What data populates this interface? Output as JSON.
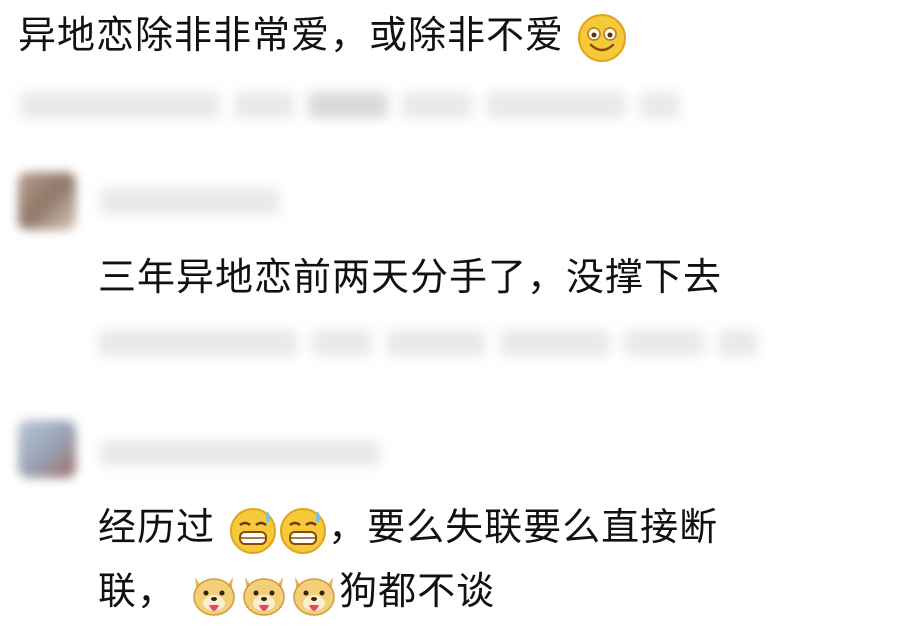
{
  "post": {
    "text": "异地恋除非非常爱，或除非不爱",
    "emoji": "smile-emoji"
  },
  "comment1": {
    "text": "三年异地恋前两天分手了，没撑下去"
  },
  "comment2": {
    "line1_before": "经历过",
    "line1_after": "，要么失联要么直接断",
    "line2_before": "联，",
    "line2_after": "狗都不谈",
    "emojis": [
      "sweat-grin-emoji",
      "sweat-grin-emoji",
      "doge-tongue-emoji",
      "doge-tongue-emoji",
      "doge-tongue-emoji"
    ]
  }
}
